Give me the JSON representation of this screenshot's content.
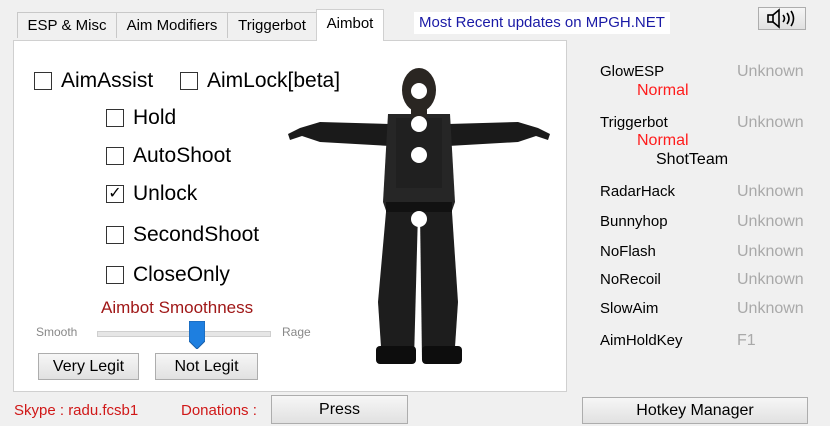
{
  "tabs": [
    {
      "label": "ESP & Misc"
    },
    {
      "label": "Aim Modifiers"
    },
    {
      "label": "Triggerbot"
    },
    {
      "label": "Aimbot"
    }
  ],
  "header": {
    "updates_label": "Most Recent updates on MPGH.NET",
    "updates_color": "#1a1aa6",
    "sound_icon": "speaker-icon"
  },
  "aimbot": {
    "aim_assist": {
      "label": "AimAssist",
      "checked": false
    },
    "aim_lock": {
      "label": "AimLock[beta]",
      "checked": false
    },
    "options": [
      {
        "label": "Hold",
        "checked": false
      },
      {
        "label": "AutoShoot",
        "checked": false
      },
      {
        "label": "Unlock",
        "checked": true
      },
      {
        "label": "SecondShoot",
        "checked": false
      },
      {
        "label": "CloseOnly",
        "checked": false
      }
    ],
    "smoothness_title": "Aimbot Smoothness",
    "smooth_min_label": "Smooth",
    "smooth_max_label": "Rage",
    "smoothness_level": 0.58,
    "very_legit_label": "Very Legit",
    "not_legit_label": "Not Legit"
  },
  "status": [
    {
      "name": "GlowESP",
      "value": "Unknown",
      "sub": "Normal"
    },
    {
      "name": "Triggerbot",
      "value": "Unknown",
      "sub": "Normal",
      "sub2": "ShotTeam"
    },
    {
      "name": "RadarHack",
      "value": "Unknown"
    },
    {
      "name": "Bunnyhop",
      "value": "Unknown"
    },
    {
      "name": "NoFlash",
      "value": "Unknown"
    },
    {
      "name": "NoRecoil",
      "value": "Unknown"
    },
    {
      "name": "SlowAim",
      "value": "Unknown"
    },
    {
      "name": "AimHoldKey",
      "value": "F1"
    }
  ],
  "footer": {
    "skype": "Skype : radu.fcsb1",
    "donations": "Donations :",
    "press_label": "Press",
    "hotkey_label": "Hotkey Manager"
  },
  "colors": {
    "accent_red": "#ff1c1c",
    "dark_red": "#a01818",
    "slider_thumb": "#1e7fe0"
  }
}
